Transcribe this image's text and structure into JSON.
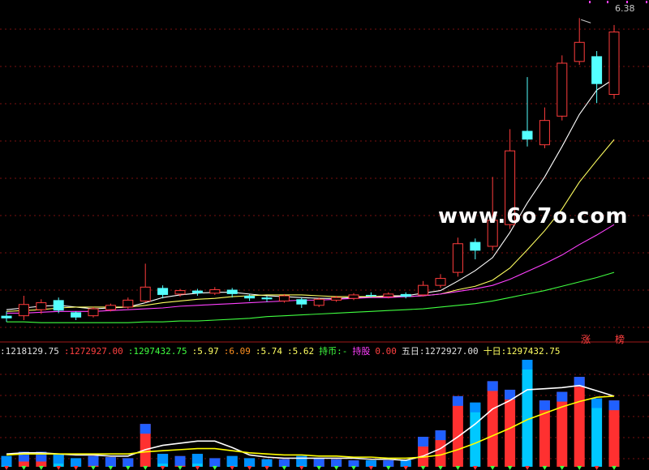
{
  "chart_data": {
    "type": "candlestick",
    "high_label": "6.38",
    "tags": {
      "up": "涨",
      "board": "榜"
    },
    "watermark": "www.6o7o.com",
    "status": {
      "v1": ":1218129.75",
      "v2": ":1272927.00",
      "v3": ":1297432.75",
      "p1": ":5.97",
      "p2": ":6.09",
      "p3": ":5.74",
      "p4": ":5.62",
      "hold_coin": "持币:-",
      "hold_stock": "持股",
      "hold_val": "0.00",
      "five_day": "五日:1272927.00",
      "ten_day": "十日:1297432.75"
    },
    "price_range": [
      2.9,
      6.42
    ],
    "volume_max": 1.0,
    "candles": [
      {
        "o": 2.95,
        "c": 2.92,
        "h": 3.0,
        "l": 2.88,
        "v": 0.1
      },
      {
        "o": 2.95,
        "c": 3.08,
        "h": 3.18,
        "l": 2.9,
        "v": 0.14
      },
      {
        "o": 3.02,
        "c": 3.1,
        "h": 3.14,
        "l": 2.97,
        "v": 0.14
      },
      {
        "o": 3.13,
        "c": 3.01,
        "h": 3.16,
        "l": 2.98,
        "v": 0.12
      },
      {
        "o": 2.99,
        "c": 2.93,
        "h": 3.0,
        "l": 2.9,
        "v": 0.08
      },
      {
        "o": 2.95,
        "c": 3.03,
        "h": 3.05,
        "l": 2.93,
        "v": 0.1
      },
      {
        "o": 3.02,
        "c": 3.07,
        "h": 3.09,
        "l": 3.0,
        "v": 0.09
      },
      {
        "o": 3.05,
        "c": 3.13,
        "h": 3.16,
        "l": 3.03,
        "v": 0.08
      },
      {
        "o": 3.12,
        "c": 3.28,
        "h": 3.55,
        "l": 3.1,
        "v": 0.4
      },
      {
        "o": 3.27,
        "c": 3.19,
        "h": 3.3,
        "l": 3.15,
        "v": 0.12
      },
      {
        "o": 3.2,
        "c": 3.24,
        "h": 3.26,
        "l": 3.17,
        "v": 0.1
      },
      {
        "o": 3.24,
        "c": 3.21,
        "h": 3.26,
        "l": 3.18,
        "v": 0.12
      },
      {
        "o": 3.21,
        "c": 3.25,
        "h": 3.28,
        "l": 3.19,
        "v": 0.08
      },
      {
        "o": 3.25,
        "c": 3.2,
        "h": 3.27,
        "l": 3.16,
        "v": 0.1
      },
      {
        "o": 3.18,
        "c": 3.15,
        "h": 3.2,
        "l": 3.12,
        "v": 0.08
      },
      {
        "o": 3.16,
        "c": 3.14,
        "h": 3.18,
        "l": 3.11,
        "v": 0.07
      },
      {
        "o": 3.12,
        "c": 3.18,
        "h": 3.2,
        "l": 3.1,
        "v": 0.07
      },
      {
        "o": 3.14,
        "c": 3.08,
        "h": 3.16,
        "l": 3.04,
        "v": 0.1
      },
      {
        "o": 3.07,
        "c": 3.14,
        "h": 3.16,
        "l": 3.05,
        "v": 0.08
      },
      {
        "o": 3.13,
        "c": 3.16,
        "h": 3.18,
        "l": 3.11,
        "v": 0.07
      },
      {
        "o": 3.15,
        "c": 3.19,
        "h": 3.21,
        "l": 3.13,
        "v": 0.06
      },
      {
        "o": 3.19,
        "c": 3.18,
        "h": 3.22,
        "l": 3.16,
        "v": 0.06
      },
      {
        "o": 3.17,
        "c": 3.2,
        "h": 3.22,
        "l": 3.15,
        "v": 0.06
      },
      {
        "o": 3.2,
        "c": 3.17,
        "h": 3.22,
        "l": 3.15,
        "v": 0.06
      },
      {
        "o": 3.19,
        "c": 3.3,
        "h": 3.35,
        "l": 3.17,
        "v": 0.28
      },
      {
        "o": 3.3,
        "c": 3.38,
        "h": 3.43,
        "l": 3.27,
        "v": 0.34
      },
      {
        "o": 3.45,
        "c": 3.78,
        "h": 3.85,
        "l": 3.4,
        "v": 0.66
      },
      {
        "o": 3.8,
        "c": 3.7,
        "h": 3.84,
        "l": 3.6,
        "v": 0.6
      },
      {
        "o": 3.75,
        "c": 4.05,
        "h": 4.55,
        "l": 3.7,
        "v": 0.8
      },
      {
        "o": 4.0,
        "c": 4.85,
        "h": 5.1,
        "l": 3.95,
        "v": 0.72
      },
      {
        "o": 5.08,
        "c": 4.98,
        "h": 5.7,
        "l": 4.9,
        "v": 1.0
      },
      {
        "o": 4.92,
        "c": 5.2,
        "h": 5.35,
        "l": 4.88,
        "v": 0.62
      },
      {
        "o": 5.25,
        "c": 5.86,
        "h": 5.95,
        "l": 5.2,
        "v": 0.7
      },
      {
        "o": 5.88,
        "c": 6.1,
        "h": 6.38,
        "l": 5.84,
        "v": 0.84
      },
      {
        "o": 5.94,
        "c": 5.62,
        "h": 6.0,
        "l": 5.4,
        "v": 0.64
      },
      {
        "o": 5.5,
        "c": 6.22,
        "h": 6.3,
        "l": 5.45,
        "v": 0.62
      }
    ],
    "ma": [
      {
        "name": "",
        "color": "#ffffff",
        "points": [
          3.02,
          3.04,
          3.06,
          3.07,
          3.05,
          3.03,
          3.04,
          3.05,
          3.1,
          3.16,
          3.19,
          3.21,
          3.22,
          3.22,
          3.2,
          3.18,
          3.17,
          3.16,
          3.15,
          3.15,
          3.16,
          3.17,
          3.18,
          3.18,
          3.21,
          3.24,
          3.35,
          3.47,
          3.62,
          3.91,
          4.25,
          4.55,
          4.9,
          5.27,
          5.55,
          5.68
        ]
      },
      {
        "name": "",
        "color": "#ffff60",
        "points": [
          3.0,
          3.01,
          3.02,
          3.04,
          3.05,
          3.05,
          3.05,
          3.05,
          3.07,
          3.1,
          3.12,
          3.14,
          3.15,
          3.17,
          3.18,
          3.19,
          3.19,
          3.19,
          3.18,
          3.17,
          3.17,
          3.17,
          3.17,
          3.17,
          3.18,
          3.2,
          3.25,
          3.29,
          3.36,
          3.5,
          3.71,
          3.93,
          4.18,
          4.49,
          4.74,
          4.98
        ]
      },
      {
        "name": "",
        "color": "#ff40ff",
        "points": [
          2.98,
          2.98,
          2.99,
          3.0,
          3.0,
          3.0,
          3.01,
          3.02,
          3.03,
          3.04,
          3.06,
          3.07,
          3.08,
          3.09,
          3.1,
          3.11,
          3.12,
          3.13,
          3.13,
          3.14,
          3.15,
          3.16,
          3.16,
          3.17,
          3.18,
          3.2,
          3.23,
          3.26,
          3.3,
          3.37,
          3.46,
          3.55,
          3.65,
          3.77,
          3.88,
          4.0
        ]
      },
      {
        "name": "",
        "color": "#40ff40",
        "points": [
          2.88,
          2.88,
          2.87,
          2.87,
          2.87,
          2.87,
          2.87,
          2.87,
          2.88,
          2.88,
          2.89,
          2.89,
          2.9,
          2.91,
          2.92,
          2.94,
          2.95,
          2.96,
          2.97,
          2.98,
          2.99,
          3.0,
          3.01,
          3.02,
          3.03,
          3.05,
          3.07,
          3.09,
          3.12,
          3.16,
          3.2,
          3.24,
          3.29,
          3.34,
          3.39,
          3.45
        ]
      }
    ],
    "vol_ma": [
      {
        "name": "",
        "color": "#ffffff",
        "points": [
          0.12,
          0.13,
          0.13,
          0.12,
          0.11,
          0.11,
          0.1,
          0.1,
          0.16,
          0.2,
          0.22,
          0.24,
          0.24,
          0.18,
          0.11,
          0.09,
          0.08,
          0.08,
          0.08,
          0.08,
          0.08,
          0.07,
          0.07,
          0.06,
          0.1,
          0.17,
          0.28,
          0.4,
          0.54,
          0.62,
          0.72,
          0.73,
          0.74,
          0.76,
          0.71,
          0.66
        ]
      },
      {
        "name": "",
        "color": "#ffff00",
        "points": [
          0.11,
          0.12,
          0.12,
          0.12,
          0.12,
          0.12,
          0.12,
          0.12,
          0.14,
          0.15,
          0.16,
          0.17,
          0.17,
          0.15,
          0.13,
          0.12,
          0.11,
          0.11,
          0.1,
          0.1,
          0.09,
          0.09,
          0.08,
          0.08,
          0.09,
          0.11,
          0.16,
          0.22,
          0.29,
          0.36,
          0.44,
          0.5,
          0.56,
          0.61,
          0.65,
          0.66
        ]
      }
    ]
  }
}
